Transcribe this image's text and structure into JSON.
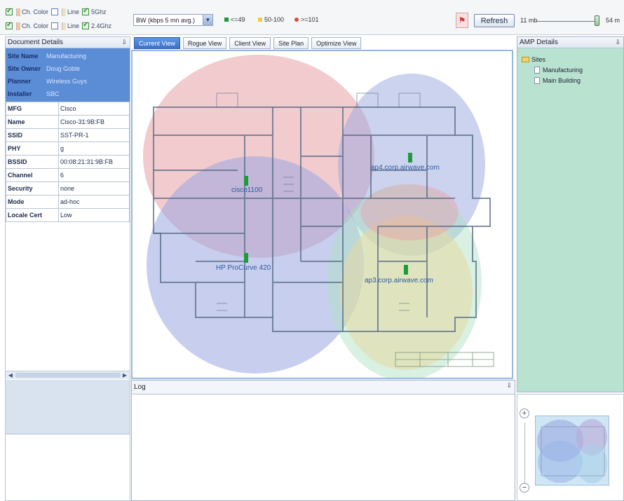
{
  "toolbar": {
    "row1": {
      "color_label": "Ch. Color",
      "line_label": "Line",
      "band_label": "5Ghz"
    },
    "row2": {
      "color_label": "Ch. Color",
      "line_label": "Line",
      "band_label": "2.4Ghz"
    },
    "bandwidth_select": "BW (kbps 5 mn avg.)",
    "legend": [
      {
        "label": "<=49",
        "color": "#1e9a3a"
      },
      {
        "label": "50-100",
        "color": "#f2cc3a"
      },
      {
        "label": ">=101",
        "color": "#e64a3a"
      }
    ],
    "refresh_label": "Refresh",
    "slider_min": "11 mb",
    "slider_max": "54 m"
  },
  "left": {
    "header": "Document Details",
    "site": [
      {
        "k": "Site Name",
        "v": "Manufacturing"
      },
      {
        "k": "Site Owner",
        "v": "Doug Goble"
      },
      {
        "k": "Planner",
        "v": "Wireless Guys"
      },
      {
        "k": "Installer",
        "v": "SBC"
      }
    ],
    "props": [
      {
        "k": "MFG",
        "v": "Cisco"
      },
      {
        "k": "Name",
        "v": "Cisco-31:9B:FB"
      },
      {
        "k": "SSID",
        "v": "SST-PR-1"
      },
      {
        "k": "PHY",
        "v": "g"
      },
      {
        "k": "BSSID",
        "v": "00:08:21:31:9B:FB"
      },
      {
        "k": "Channel",
        "v": "6"
      },
      {
        "k": "Security",
        "v": "none"
      },
      {
        "k": "Mode",
        "v": "ad-hoc"
      },
      {
        "k": "Locale Cert",
        "v": "Low"
      }
    ]
  },
  "tabs": [
    "Current View",
    "Rogue View",
    "Client View",
    "Site Plan",
    "Optimize View"
  ],
  "map": {
    "aps": [
      {
        "label": "cisco1100"
      },
      {
        "label": "ap4.corp.airwave.com"
      },
      {
        "label": "HP ProCurve 420"
      },
      {
        "label": "ap3.corp.airwave.com"
      }
    ]
  },
  "log": {
    "header": "Log"
  },
  "right": {
    "header": "AMP Details",
    "tree_root": "Sites",
    "tree_children": [
      "Manufacturing",
      "Main Building"
    ]
  },
  "mini": {
    "zoom_in": "+",
    "zoom_out": "−"
  },
  "colors": {
    "accent": "#3d71c5",
    "coverage_red": "#e8a0a8",
    "coverage_blue": "#9aa8e0",
    "coverage_green": "#a8e0c0",
    "coverage_yellow": "#e8d8a0"
  }
}
